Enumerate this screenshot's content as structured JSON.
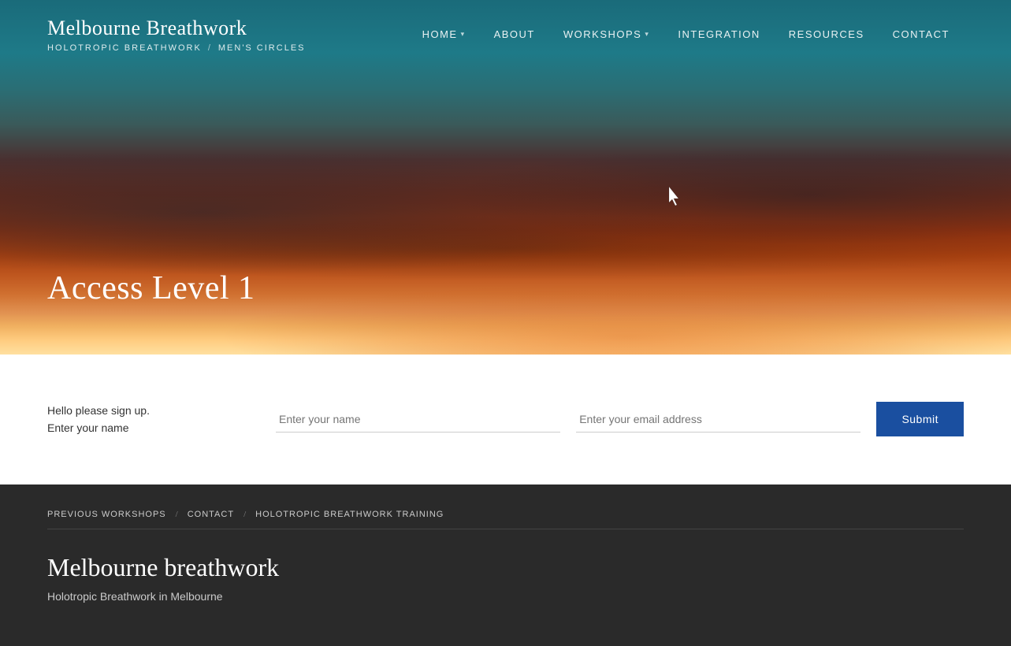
{
  "brand": {
    "name": "Melbourne Breathwork",
    "sub1": "HOLOTROPIC BREATHWORK",
    "separator": "/",
    "sub2": "MEN'S CIRCLES"
  },
  "nav": {
    "items": [
      {
        "label": "HOME",
        "hasDropdown": true
      },
      {
        "label": "ABOUT",
        "hasDropdown": false
      },
      {
        "label": "WORKSHOPS",
        "hasDropdown": true
      },
      {
        "label": "INTEGRATION",
        "hasDropdown": false
      },
      {
        "label": "RESOURCES",
        "hasDropdown": false
      },
      {
        "label": "CONTACT",
        "hasDropdown": false
      }
    ]
  },
  "hero": {
    "title": "Access Level 1"
  },
  "signup": {
    "line1": "Hello please sign up.",
    "line2": "Enter your name",
    "name_placeholder": "Enter your name",
    "email_placeholder": "Enter your email address",
    "submit_label": "Submit"
  },
  "footer": {
    "nav": [
      {
        "label": "PREVIOUS WORKSHOPS"
      },
      {
        "label": "CONTACT"
      },
      {
        "label": "HOLOTROPIC BREATHWORK TRAINING"
      }
    ],
    "title": "Melbourne breathwork",
    "subtitle": "Holotropic Breathwork in Melbourne"
  }
}
